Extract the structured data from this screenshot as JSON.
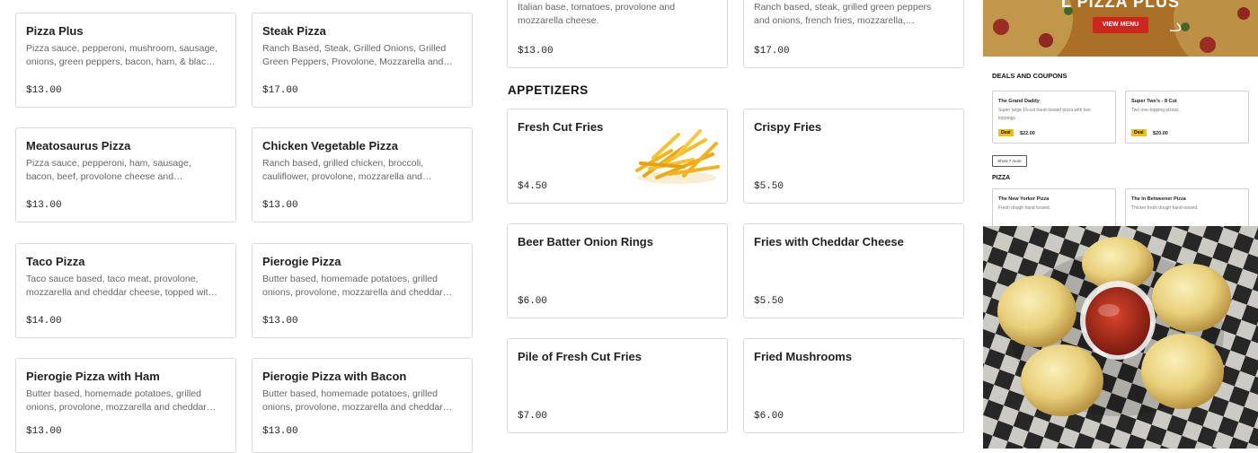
{
  "pizza_items": [
    {
      "name": "",
      "desc": "",
      "price": ""
    },
    {
      "name": "Pizza Plus",
      "desc": "Pizza sauce, pepperoni, mushroom, sausage, onions, green peppers, bacon, ham, & black olives.",
      "price": "$13.00"
    },
    {
      "name": "Steak Pizza",
      "desc": "Ranch Based, Steak, Grilled Onions, Grilled Green Peppers, Provolone, Mozzarella and Cheddar.",
      "price": "$17.00"
    },
    {
      "name": "Meatosaurus Pizza",
      "desc": "Pizza sauce, pepperoni, ham, sausage, bacon, beef, provolone cheese and mozzarella cheese.",
      "price": "$13.00"
    },
    {
      "name": "Chicken Vegetable Pizza",
      "desc": "Ranch based, grilled chicken, broccoli, cauliflower, provolone, mozzarella and cheddar cheese.",
      "price": "$13.00"
    },
    {
      "name": "Taco Pizza",
      "desc": "Taco sauce based, taco meat, provolone, mozzarella and cheddar cheese, topped with lettuce.",
      "price": "$14.00"
    },
    {
      "name": "Pierogie Pizza",
      "desc": "Butter based, homemade potatoes, grilled onions, provolone, mozzarella and cheddar cheese.",
      "price": "$13.00"
    },
    {
      "name": "Pierogie Pizza with Ham",
      "desc": "Butter based, homemade potatoes, grilled onions, provolone, mozzarella and cheddar cheese.",
      "price": "$13.00"
    },
    {
      "name": "Pierogie Pizza with Bacon",
      "desc": "Butter based, homemade potatoes, grilled onions, provolone, mozzarella and cheddar cheese.",
      "price": "$13.00"
    }
  ],
  "top_cards": [
    {
      "desc": "Italian base, tomatoes, provolone and mozzarella cheese.",
      "price": "$13.00"
    },
    {
      "desc": "Ranch based, steak, grilled green peppers and onions, french fries, mozzarella, provolone and cheddar.",
      "price": "$17.00"
    }
  ],
  "appetizers": {
    "title": "APPETIZERS",
    "items": [
      {
        "name": "Fresh Cut Fries",
        "price": "$4.50"
      },
      {
        "name": "Crispy Fries",
        "price": "$5.50"
      },
      {
        "name": "Beer Batter Onion Rings",
        "price": "$6.00"
      },
      {
        "name": "Fries with Cheddar Cheese",
        "price": "$5.50"
      },
      {
        "name": "Pile of Fresh Cut Fries",
        "price": "$7.00"
      },
      {
        "name": "Fried Mushrooms",
        "price": "$6.00"
      }
    ]
  },
  "side_panel": {
    "banner_title": "L PIZZA PLUS",
    "view_menu_label": "VIEW MENU",
    "deals_heading": "DEALS AND COUPONS",
    "deals": [
      {
        "title": "The Grand Daddy",
        "desc": "Super large 16-cut hand-tossed pizza with two toppings.",
        "tag": "Deal",
        "price": "$22.00"
      },
      {
        "title": "Super Two's - 8 Cut",
        "desc": "Two one-topping pizzas.",
        "tag": "Deal",
        "price": "$20.00"
      }
    ],
    "show_more_label": "Show 7 more",
    "pizza_heading": "PIZZA",
    "pizzas": [
      {
        "title": "The New Yorker Pizza",
        "desc": "Fresh dough hand tossed."
      },
      {
        "title": "The In Betweener Pizza",
        "desc": "Thicker fresh dough hand-tossed."
      }
    ]
  },
  "colors": {
    "brand_red": "#d0241f",
    "card_border": "#d9d9d9",
    "deal_yellow": "#f2c200"
  }
}
